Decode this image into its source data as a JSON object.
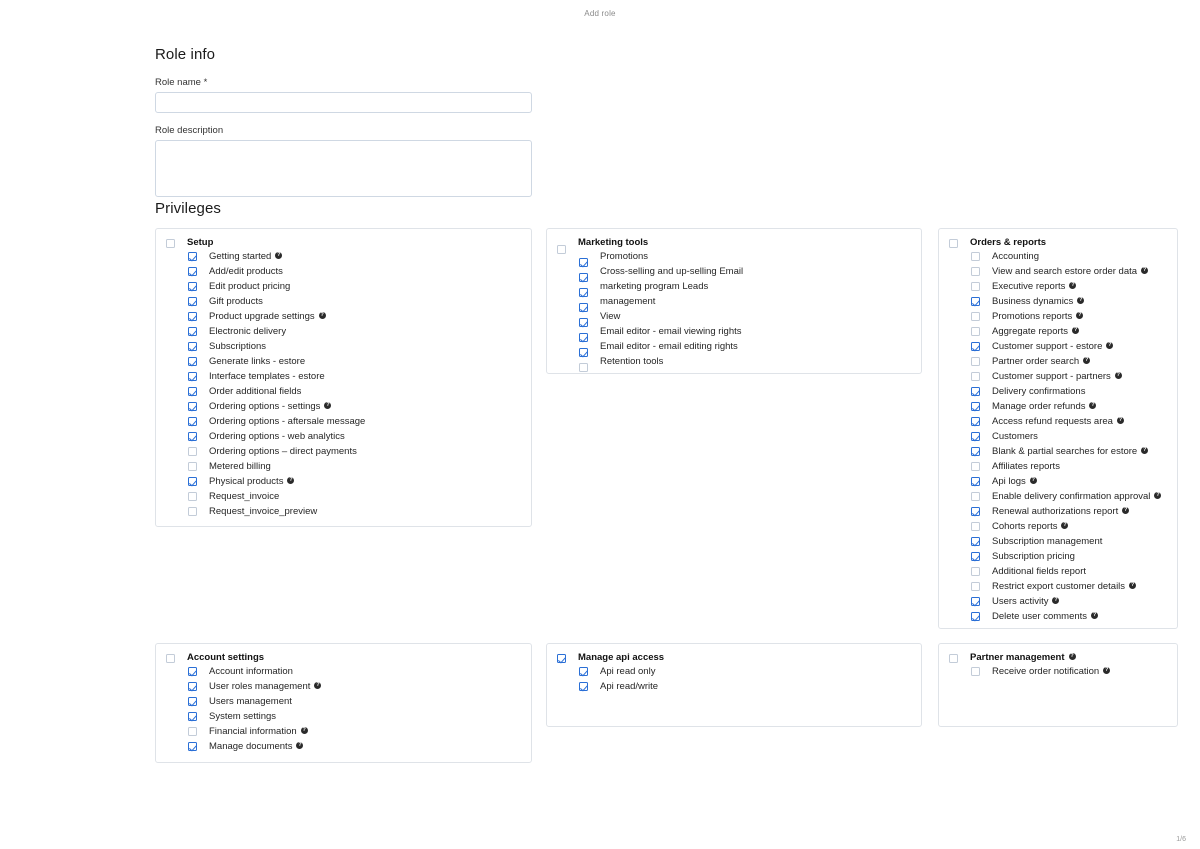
{
  "header": {
    "title": "Add role"
  },
  "footer": {
    "page": "1/6"
  },
  "role_info": {
    "heading": "Role info",
    "name_label": "Role name *",
    "name_value": "",
    "name_placeholder": "",
    "description_label": "Role description",
    "description_value": "",
    "description_placeholder": ""
  },
  "privileges": {
    "heading": "Privileges",
    "help_glyph": "?",
    "groups": [
      {
        "id": "setup",
        "title": "Setup",
        "checked": false,
        "help": false,
        "offset_boxes": false,
        "items": [
          {
            "label": "Getting started",
            "checked": true,
            "help": true
          },
          {
            "label": "Add/edit products",
            "checked": true,
            "help": false
          },
          {
            "label": "Edit product pricing",
            "checked": true,
            "help": false
          },
          {
            "label": "Gift products",
            "checked": true,
            "help": false
          },
          {
            "label": "Product upgrade settings",
            "checked": true,
            "help": true
          },
          {
            "label": "Electronic delivery",
            "checked": true,
            "help": false
          },
          {
            "label": "Subscriptions",
            "checked": true,
            "help": false
          },
          {
            "label": "Generate links - estore",
            "checked": true,
            "help": false
          },
          {
            "label": "Interface templates - estore",
            "checked": true,
            "help": false
          },
          {
            "label": "Order additional fields",
            "checked": true,
            "help": false
          },
          {
            "label": "Ordering options - settings",
            "checked": true,
            "help": true
          },
          {
            "label": "Ordering options - aftersale message",
            "checked": true,
            "help": false
          },
          {
            "label": "Ordering options - web analytics",
            "checked": true,
            "help": false
          },
          {
            "label": "Ordering options – direct payments",
            "checked": false,
            "help": false
          },
          {
            "label": "Metered billing",
            "checked": false,
            "help": false
          },
          {
            "label": "Physical products",
            "checked": true,
            "help": true
          },
          {
            "label": "Request_invoice",
            "checked": false,
            "help": false
          },
          {
            "label": "Request_invoice_preview",
            "checked": false,
            "help": false
          }
        ]
      },
      {
        "id": "marketing-tools",
        "title": "Marketing tools",
        "checked": false,
        "help": false,
        "offset_boxes": true,
        "items": [
          {
            "label": "Promotions",
            "checked": true,
            "help": false
          },
          {
            "label": "Cross-selling and up-selling Email",
            "checked": true,
            "help": false
          },
          {
            "label": "marketing program Leads",
            "checked": true,
            "help": false
          },
          {
            "label": "management",
            "checked": true,
            "help": false
          },
          {
            "label": "View",
            "checked": true,
            "help": false
          },
          {
            "label": "Email editor - email viewing rights",
            "checked": true,
            "help": false
          },
          {
            "label": "Email editor - email editing rights",
            "checked": true,
            "help": false
          },
          {
            "label": "Retention tools",
            "checked": false,
            "help": false
          }
        ]
      },
      {
        "id": "orders-reports",
        "title": "Orders & reports",
        "checked": false,
        "help": false,
        "offset_boxes": false,
        "items": [
          {
            "label": "Accounting",
            "checked": false,
            "help": false
          },
          {
            "label": "View and search estore order data",
            "checked": false,
            "help": true
          },
          {
            "label": "Executive reports",
            "checked": false,
            "help": true
          },
          {
            "label": "Business dynamics",
            "checked": true,
            "help": true
          },
          {
            "label": "Promotions reports",
            "checked": false,
            "help": true
          },
          {
            "label": "Aggregate reports",
            "checked": false,
            "help": true
          },
          {
            "label": "Customer support - estore",
            "checked": true,
            "help": true
          },
          {
            "label": "Partner order search",
            "checked": false,
            "help": true
          },
          {
            "label": "Customer support - partners",
            "checked": false,
            "help": true
          },
          {
            "label": "Delivery confirmations",
            "checked": true,
            "help": false
          },
          {
            "label": "Manage order refunds",
            "checked": true,
            "help": true
          },
          {
            "label": "Access refund requests area",
            "checked": true,
            "help": true
          },
          {
            "label": "Customers",
            "checked": true,
            "help": false
          },
          {
            "label": "Blank & partial searches for estore",
            "checked": true,
            "help": true
          },
          {
            "label": "Affiliates reports",
            "checked": false,
            "help": false
          },
          {
            "label": "Api logs",
            "checked": true,
            "help": true
          },
          {
            "label": "Enable delivery confirmation approval",
            "checked": false,
            "help": true
          },
          {
            "label": "Renewal authorizations report",
            "checked": true,
            "help": true
          },
          {
            "label": "Cohorts reports",
            "checked": false,
            "help": true
          },
          {
            "label": "Subscription management",
            "checked": true,
            "help": false
          },
          {
            "label": "Subscription pricing",
            "checked": true,
            "help": false
          },
          {
            "label": "Additional fields report",
            "checked": false,
            "help": false
          },
          {
            "label": "Restrict export customer details",
            "checked": false,
            "help": true
          },
          {
            "label": "Users activity",
            "checked": true,
            "help": true
          },
          {
            "label": "Delete user comments",
            "checked": true,
            "help": true
          }
        ]
      },
      {
        "id": "account-settings",
        "title": "Account settings",
        "checked": false,
        "help": false,
        "offset_boxes": false,
        "items": [
          {
            "label": "Account information",
            "checked": true,
            "help": false
          },
          {
            "label": "User roles management",
            "checked": true,
            "help": true
          },
          {
            "label": "Users management",
            "checked": true,
            "help": false
          },
          {
            "label": "System settings",
            "checked": true,
            "help": false
          },
          {
            "label": "Financial information",
            "checked": false,
            "help": true
          },
          {
            "label": "Manage documents",
            "checked": true,
            "help": true
          }
        ]
      },
      {
        "id": "manage-api-access",
        "title": "Manage api access",
        "checked": true,
        "help": false,
        "offset_boxes": false,
        "items": [
          {
            "label": "Api read only",
            "checked": true,
            "help": false
          },
          {
            "label": "Api read/write",
            "checked": true,
            "help": false
          }
        ]
      },
      {
        "id": "partner-management",
        "title": "Partner management",
        "checked": false,
        "help": true,
        "offset_boxes": false,
        "items": [
          {
            "label": "Receive order notification",
            "checked": false,
            "help": true
          }
        ]
      }
    ]
  },
  "colors": {
    "accent": "#2a6fd6",
    "card_border": "#dfe3e8",
    "input_border": "#cfd8e3",
    "text": "#262626",
    "muted": "#8a8a8a"
  }
}
